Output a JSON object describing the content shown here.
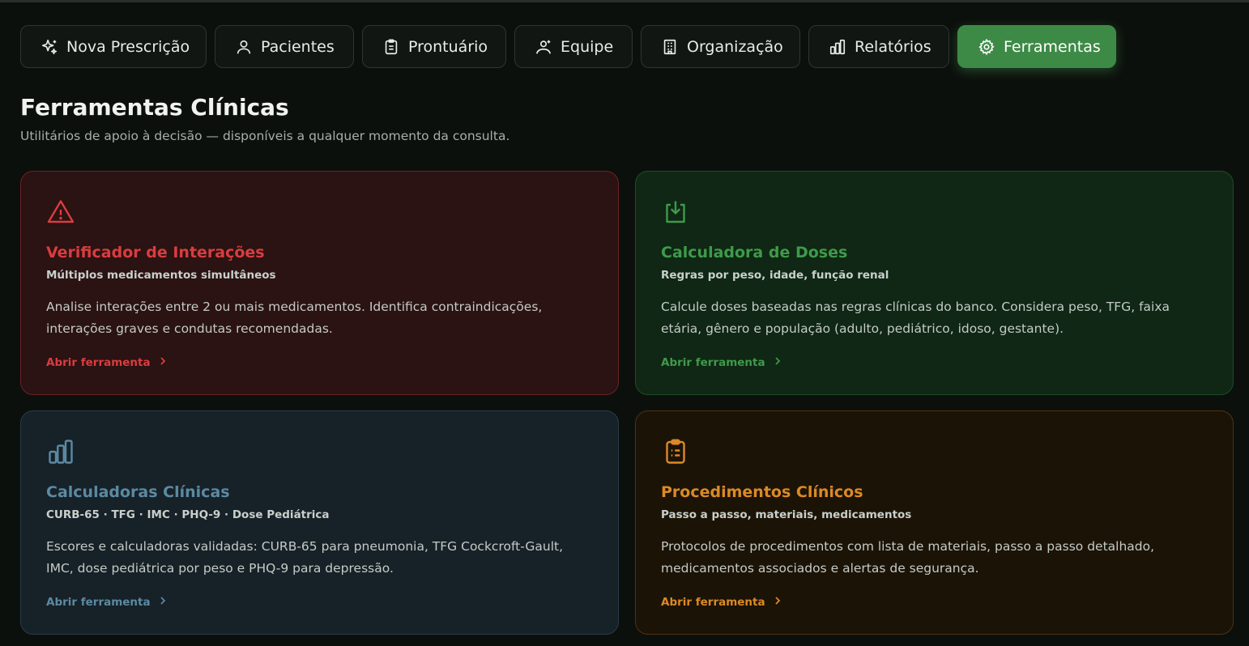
{
  "nav": {
    "tabs": [
      {
        "label": "Nova Prescrição",
        "icon": "sparkles-icon"
      },
      {
        "label": "Pacientes",
        "icon": "user-icon"
      },
      {
        "label": "Prontuário",
        "icon": "clipboard-icon"
      },
      {
        "label": "Equipe",
        "icon": "team-icon"
      },
      {
        "label": "Organização",
        "icon": "building-icon"
      },
      {
        "label": "Relatórios",
        "icon": "bar-chart-icon"
      },
      {
        "label": "Ferramentas",
        "icon": "gear-icon",
        "active": true
      }
    ]
  },
  "page": {
    "title": "Ferramentas Clínicas",
    "subtitle": "Utilitários de apoio à decisão — disponíveis a qualquer momento da consulta."
  },
  "cards": [
    {
      "icon": "warning-triangle-icon",
      "title": "Verificador de Interações",
      "subtitle": "Múltiplos medicamentos simultâneos",
      "description": "Analise interações entre 2 ou mais medicamentos. Identifica contraindicações, interações graves e condutas recomendadas.",
      "link": "Abrir ferramenta",
      "accent": "#d93d3f"
    },
    {
      "icon": "download-box-icon",
      "title": "Calculadora de Doses",
      "subtitle": "Regras por peso, idade, função renal",
      "description": "Calcule doses baseadas nas regras clínicas do banco. Considera peso, TFG, faixa etária, gênero e população (adulto, pediátrico, idoso, gestante).",
      "link": "Abrir ferramenta",
      "accent": "#3f9a4a"
    },
    {
      "icon": "bar-chart-icon",
      "title": "Calculadoras Clínicas",
      "subtitle": "CURB-65 · TFG · IMC · PHQ-9 · Dose Pediátrica",
      "description": "Escores e calculadoras validadas: CURB-65 para pneumonia, TFG Cockcroft-Gault, IMC, dose pediátrica por peso e PHQ-9 para depressão.",
      "link": "Abrir ferramenta",
      "accent": "#5b8aa2"
    },
    {
      "icon": "clipboard-list-icon",
      "title": "Procedimentos Clínicos",
      "subtitle": "Passo a passo, materiais, medicamentos",
      "description": "Protocolos de procedimentos com lista de materiais, passo a passo detalhado, medicamentos associados e alertas de segurança.",
      "link": "Abrir ferramenta",
      "accent": "#db8a26"
    }
  ]
}
